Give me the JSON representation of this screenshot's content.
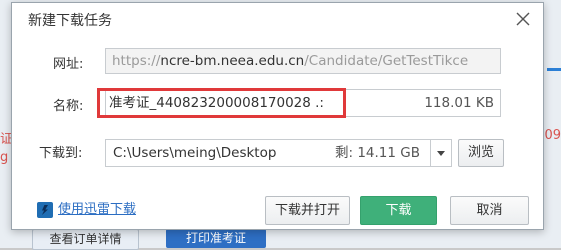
{
  "background": {
    "left_fragment_1": "证",
    "left_fragment_2": "g",
    "right_fragment": "09",
    "button_1": "查看订单详情",
    "button_2": "打印准考证"
  },
  "dialog": {
    "title": "新建下载任务",
    "url": {
      "label": "网址:",
      "prefix": "https://",
      "host": "ncre-bm.neea.edu.cn",
      "path": "/Candidate/GetTestTikce"
    },
    "name": {
      "label": "名称:",
      "value": "准考证_440823200008170028 .:",
      "size": "118.01 KB"
    },
    "download_to": {
      "label": "下载到:",
      "path": "C:\\Users\\meing\\Desktop",
      "free_space": "剩: 14.11 GB"
    },
    "browse_label": "浏览",
    "thunder_link": "使用迅雷下载",
    "open_after_label": "下载并打开",
    "download_label": "下载",
    "cancel_label": "取消"
  },
  "colors": {
    "highlight": "#e0393a",
    "download_button": "#3fb07a",
    "link": "#2b6dc2"
  }
}
